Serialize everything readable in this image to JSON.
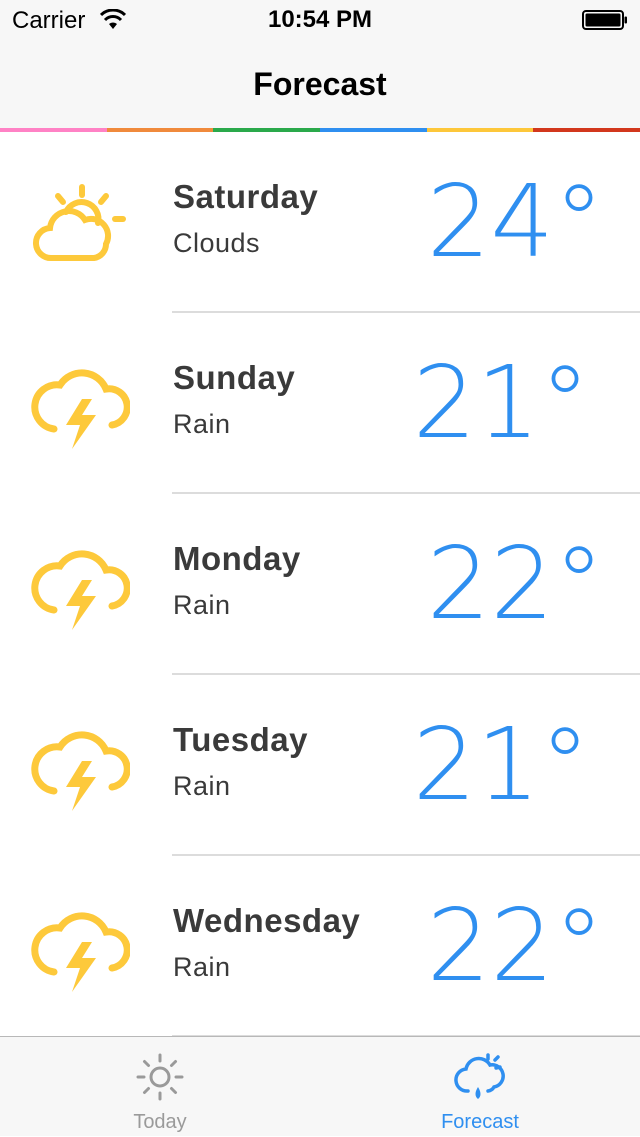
{
  "status_bar": {
    "carrier": "Carrier",
    "time": "10:54 PM"
  },
  "nav": {
    "title": "Forecast"
  },
  "stripe_colors": [
    "#ff82c5",
    "#f08a3c",
    "#2aa94b",
    "#2f8ff0",
    "#fdc73a",
    "#d2371d"
  ],
  "colors": {
    "accent": "#2f8ff0",
    "icon": "#fdc93b",
    "inactive": "#9a9a9a"
  },
  "forecast": [
    {
      "day": "Saturday",
      "condition": "Clouds",
      "temp": "24°",
      "icon": "partly-cloudy-icon"
    },
    {
      "day": "Sunday",
      "condition": "Rain",
      "temp": "21°",
      "icon": "storm-icon"
    },
    {
      "day": "Monday",
      "condition": "Rain",
      "temp": "22°",
      "icon": "storm-icon"
    },
    {
      "day": "Tuesday",
      "condition": "Rain",
      "temp": "21°",
      "icon": "storm-icon"
    },
    {
      "day": "Wednesday",
      "condition": "Rain",
      "temp": "22°",
      "icon": "storm-icon"
    }
  ],
  "tabs": [
    {
      "label": "Today",
      "icon": "sun-icon",
      "selected": false
    },
    {
      "label": "Forecast",
      "icon": "cloud-rain-icon",
      "selected": true
    }
  ]
}
